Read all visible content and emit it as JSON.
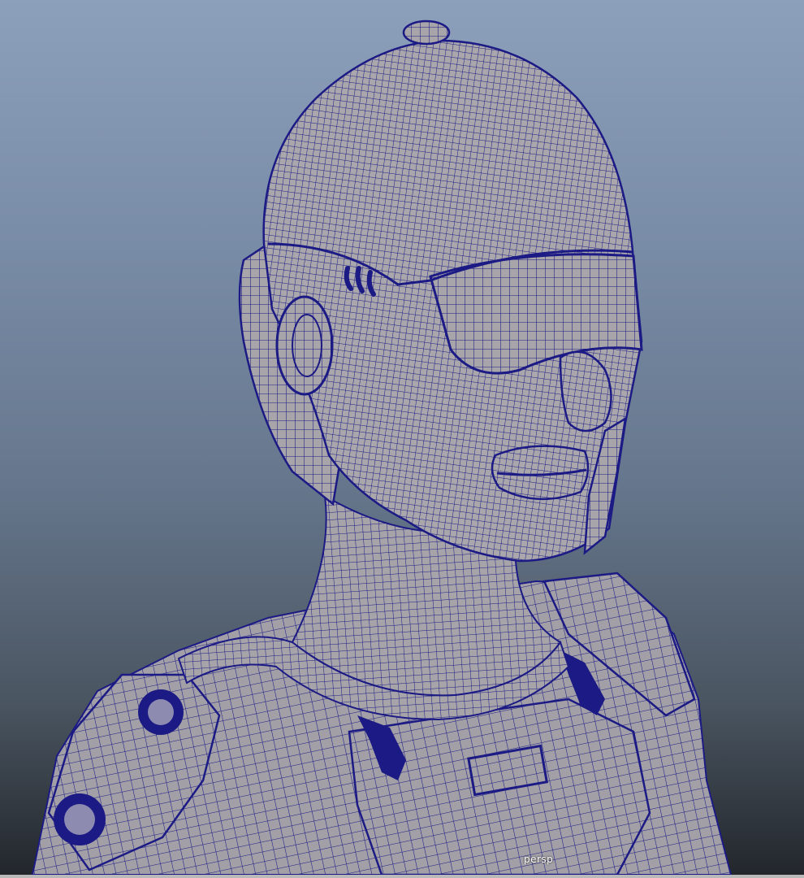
{
  "viewport": {
    "camera_label": "persp",
    "background_top": "#8c9fbb",
    "background_bottom": "#22262b"
  },
  "mesh": {
    "description_icon": "wireframe-mesh-icon",
    "surface_color": "#a7a5a9",
    "wire_color": "#1c1a84"
  }
}
